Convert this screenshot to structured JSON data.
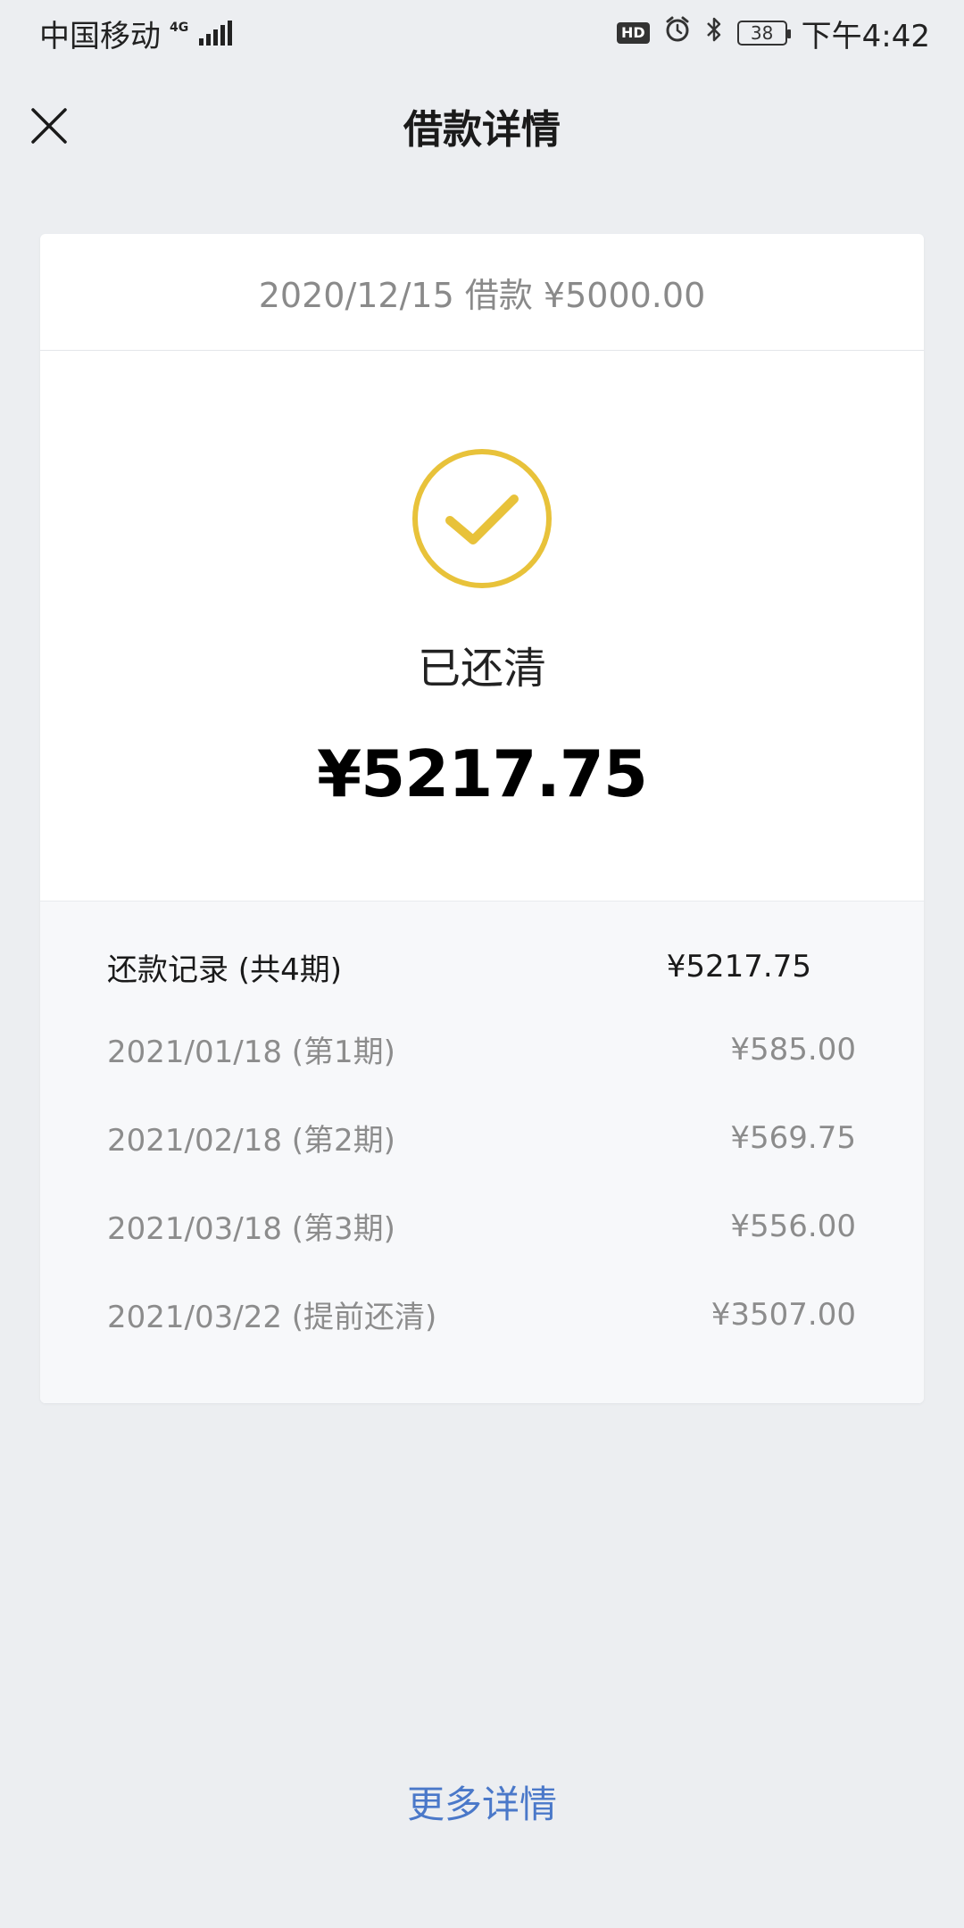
{
  "status_bar": {
    "carrier": "中国移动",
    "network": "4G",
    "hd_badge": "HD",
    "battery": "38",
    "time": "下午4:42",
    "icons": [
      "signal-icon",
      "alarm-icon",
      "bluetooth-icon",
      "battery-icon"
    ]
  },
  "nav": {
    "title": "借款详情",
    "close_icon": "close-icon"
  },
  "loan": {
    "header": "2020/12/15 借款 ¥5000.00",
    "status": "已还清",
    "total": "¥5217.75",
    "check_icon": "check-circle-icon",
    "accent_color": "#e8c23a"
  },
  "records": {
    "summary_label": "还款记录 (共4期)",
    "summary_amount": "¥5217.75",
    "items": [
      {
        "date": "2021/01/18 (第1期)",
        "amount": "¥585.00"
      },
      {
        "date": "2021/02/18 (第2期)",
        "amount": "¥569.75"
      },
      {
        "date": "2021/03/18 (第3期)",
        "amount": "¥556.00"
      },
      {
        "date": "2021/03/22 (提前还清)",
        "amount": "¥3507.00"
      }
    ]
  },
  "footer": {
    "more_link": "更多详情",
    "link_color": "#4a78c9"
  }
}
